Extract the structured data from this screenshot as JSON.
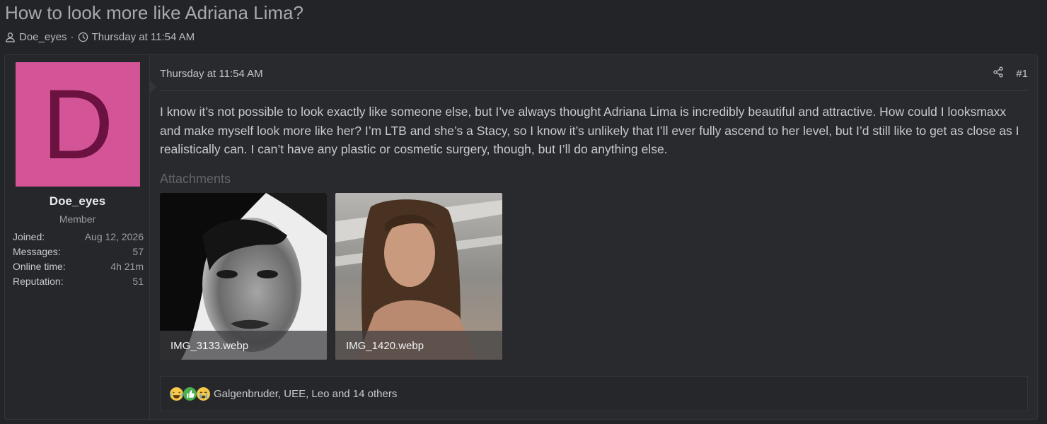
{
  "thread": {
    "title": "How to look more like Adriana Lima?",
    "author": "Doe_eyes",
    "separator": "·",
    "date": "Thursday at 11:54 AM"
  },
  "user": {
    "avatar_letter": "D",
    "avatar_color": "#d45498",
    "name": "Doe_eyes",
    "title": "Member",
    "stats": [
      {
        "label": "Joined:",
        "value": "Aug 12, 2026"
      },
      {
        "label": "Messages:",
        "value": "57"
      },
      {
        "label": "Online time:",
        "value": "4h 21m"
      },
      {
        "label": "Reputation:",
        "value": "51"
      }
    ]
  },
  "post": {
    "date": "Thursday at 11:54 AM",
    "number": "#1",
    "body": "I know it’s not possible to look exactly like someone else, but I’ve always thought Adriana Lima is incredibly beautiful and attractive. How could I looksmaxx and make myself look more like her? I’m LTB and she’s a Stacy, so I know it’s unlikely that I’ll ever fully ascend to her level, but I’d still like to get as close as I realistically can. I can’t have any plastic or cosmetic surgery, though, but I’ll do anything else.",
    "attachments_label": "Attachments",
    "attachments": [
      {
        "filename": "IMG_3133.webp"
      },
      {
        "filename": "IMG_1420.webp"
      }
    ],
    "reactions_text": "Galgenbruder, UEE, Leo and 14 others"
  },
  "icons": {
    "user": "user-icon",
    "clock": "clock-icon",
    "share": "share-icon",
    "reaction_1": "laughing-crying-icon",
    "reaction_2": "thumbs-up-icon",
    "reaction_3": "crying-icon"
  }
}
